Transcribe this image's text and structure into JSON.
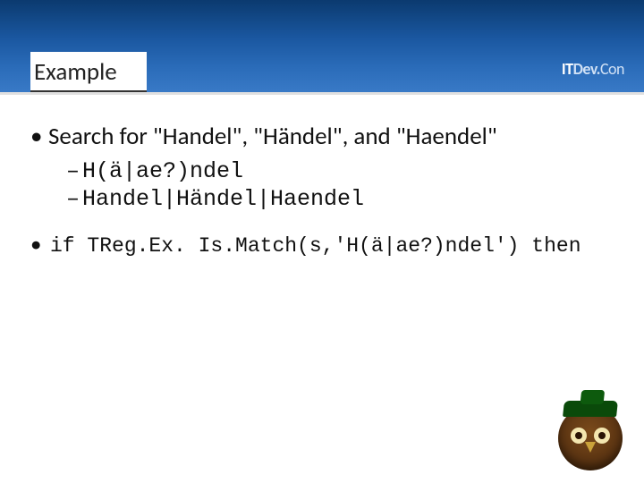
{
  "header": {
    "title": "Example",
    "brand_it": "IT",
    "brand_dev": "Dev.",
    "brand_con": "Con"
  },
  "bullets": {
    "main": "Search for \"Handel\", \"Händel\", and \"Haendel\"",
    "sub1": "H(ä|ae?)ndel",
    "sub2": "Handel|Händel|Haendel",
    "code": "if TReg.Ex. Is.Match(s,'H(ä|ae?)ndel') then"
  }
}
